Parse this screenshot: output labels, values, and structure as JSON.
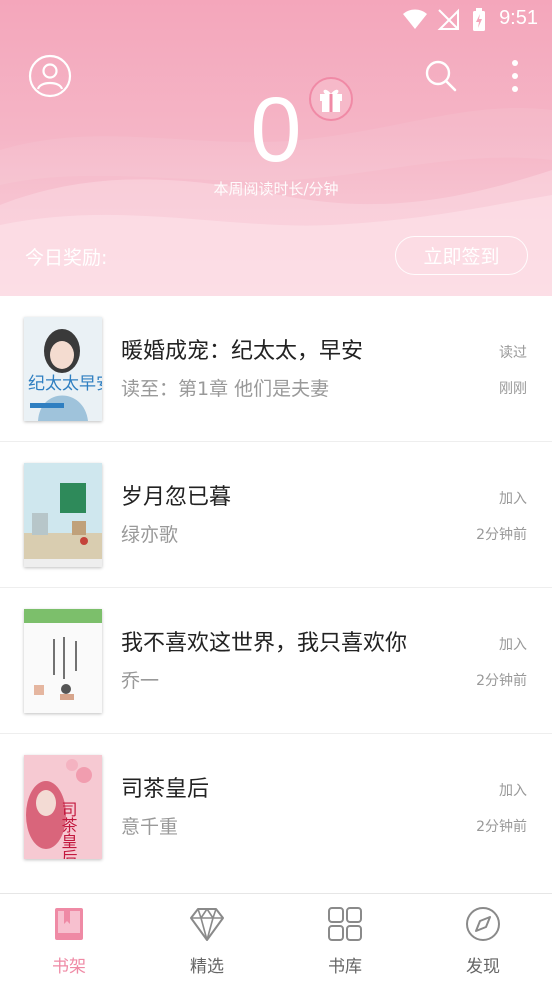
{
  "status_bar": {
    "time": "9:51"
  },
  "header": {
    "reading_minutes": "0",
    "reading_label": "本周阅读时长/分钟",
    "reward_label": "今日奖励:",
    "sign_in_button": "立即签到"
  },
  "books": [
    {
      "title": "暖婚成宠：纪太太，早安",
      "subtitle": "读至：第1章 他们是夫妻",
      "status": "读过",
      "time": "刚刚",
      "cover_text": "纪太太早安"
    },
    {
      "title": "岁月忽已暮",
      "subtitle": "绿亦歌",
      "status": "加入",
      "time": "2分钟前",
      "cover_text": ""
    },
    {
      "title": "我不喜欢这世界，我只喜欢你",
      "subtitle": "乔一",
      "status": "加入",
      "time": "2分钟前",
      "cover_text": ""
    },
    {
      "title": "司茶皇后",
      "subtitle": "意千重",
      "status": "加入",
      "time": "2分钟前",
      "cover_text": "司茶皇后"
    }
  ],
  "bottom_nav": {
    "items": [
      {
        "label": "书架",
        "icon": "bookshelf-icon",
        "active": true
      },
      {
        "label": "精选",
        "icon": "diamond-icon",
        "active": false
      },
      {
        "label": "书库",
        "icon": "grid-icon",
        "active": false
      },
      {
        "label": "发现",
        "icon": "compass-icon",
        "active": false
      }
    ]
  },
  "colors": {
    "accent": "#ef8aa5",
    "header_top": "#f4a6bb",
    "muted_text": "#999999"
  }
}
